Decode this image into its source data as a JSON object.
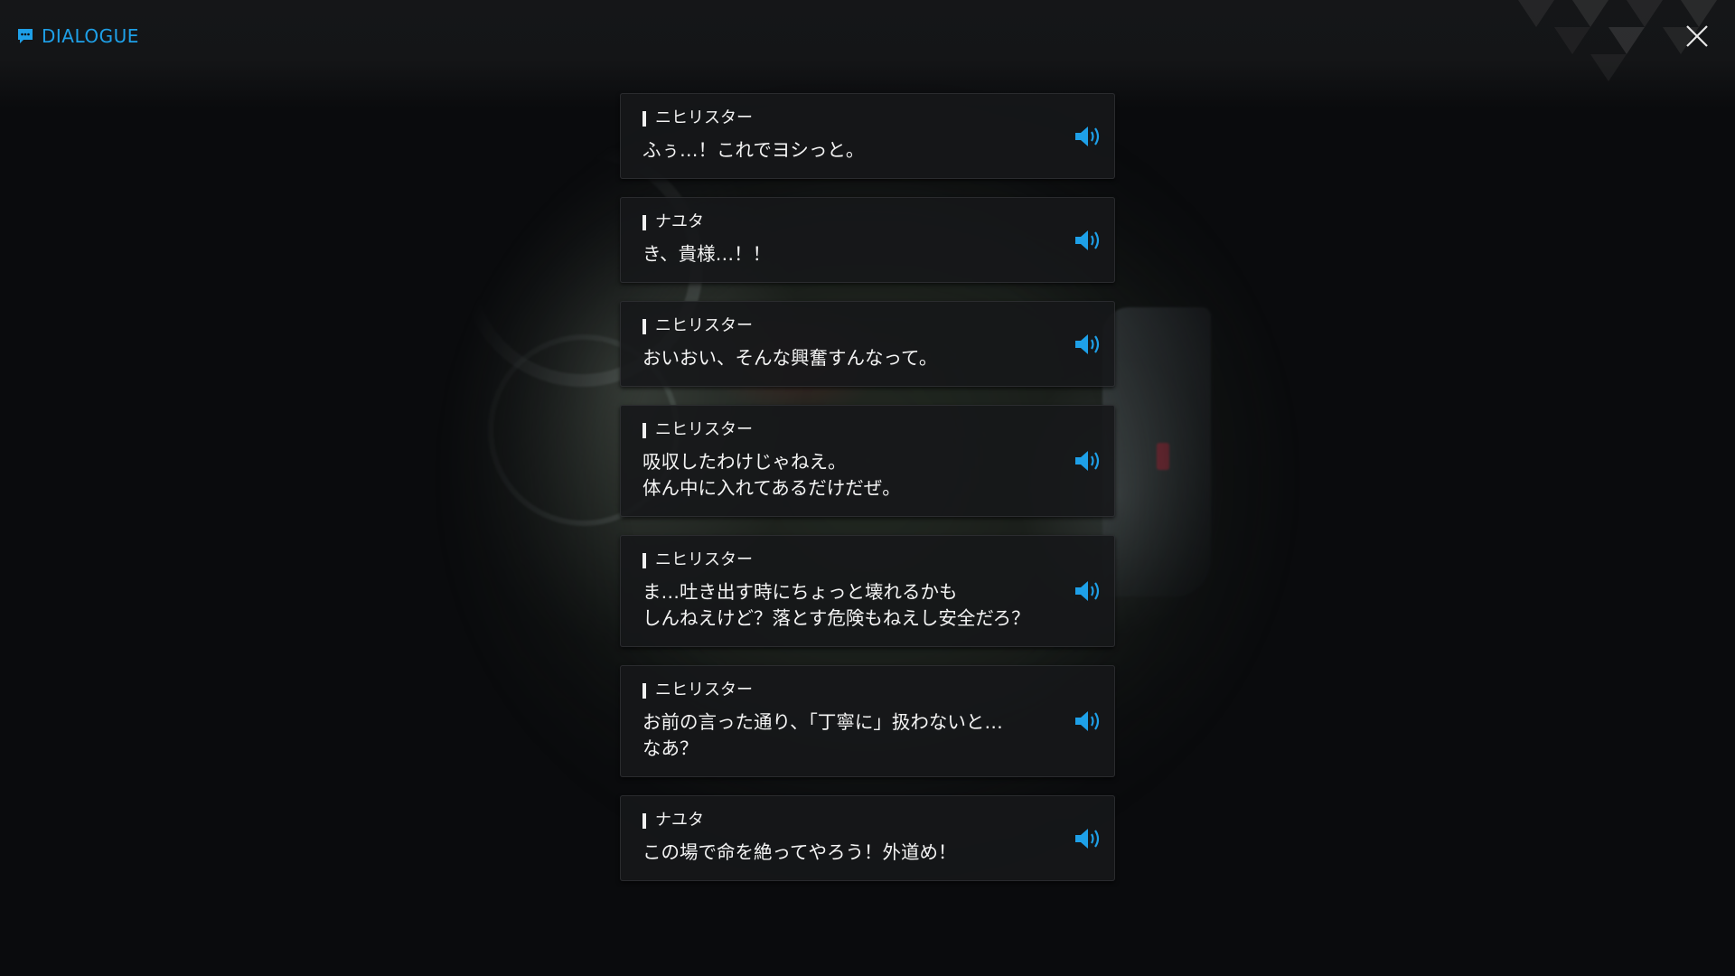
{
  "header": {
    "title": "DIALOGUE",
    "accent": "#1ea0e8"
  },
  "icons": {
    "title": "chat-bubble-icon",
    "close": "close-icon",
    "voice": "speaker-volume-icon"
  },
  "entries": [
    {
      "speaker": "ニヒリスター",
      "lines": [
        "ふぅ…！これでヨシっと。"
      ]
    },
    {
      "speaker": "ナユタ",
      "lines": [
        "き、貴様…！！"
      ]
    },
    {
      "speaker": "ニヒリスター",
      "lines": [
        "おいおい、そんな興奮すんなって。"
      ]
    },
    {
      "speaker": "ニヒリスター",
      "lines": [
        "吸収したわけじゃねえ。",
        "体ん中に入れてあるだけだぜ。"
      ]
    },
    {
      "speaker": "ニヒリスター",
      "lines": [
        "ま…吐き出す時にちょっと壊れるかも",
        "しんねえけど？落とす危険もねえし安全だろ？"
      ]
    },
    {
      "speaker": "ニヒリスター",
      "lines": [
        "お前の言った通り、「丁寧に」扱わないと…",
        "なあ？"
      ]
    },
    {
      "speaker": "ナユタ",
      "lines": [
        "この場で命を絶ってやろう！外道め！"
      ]
    }
  ]
}
